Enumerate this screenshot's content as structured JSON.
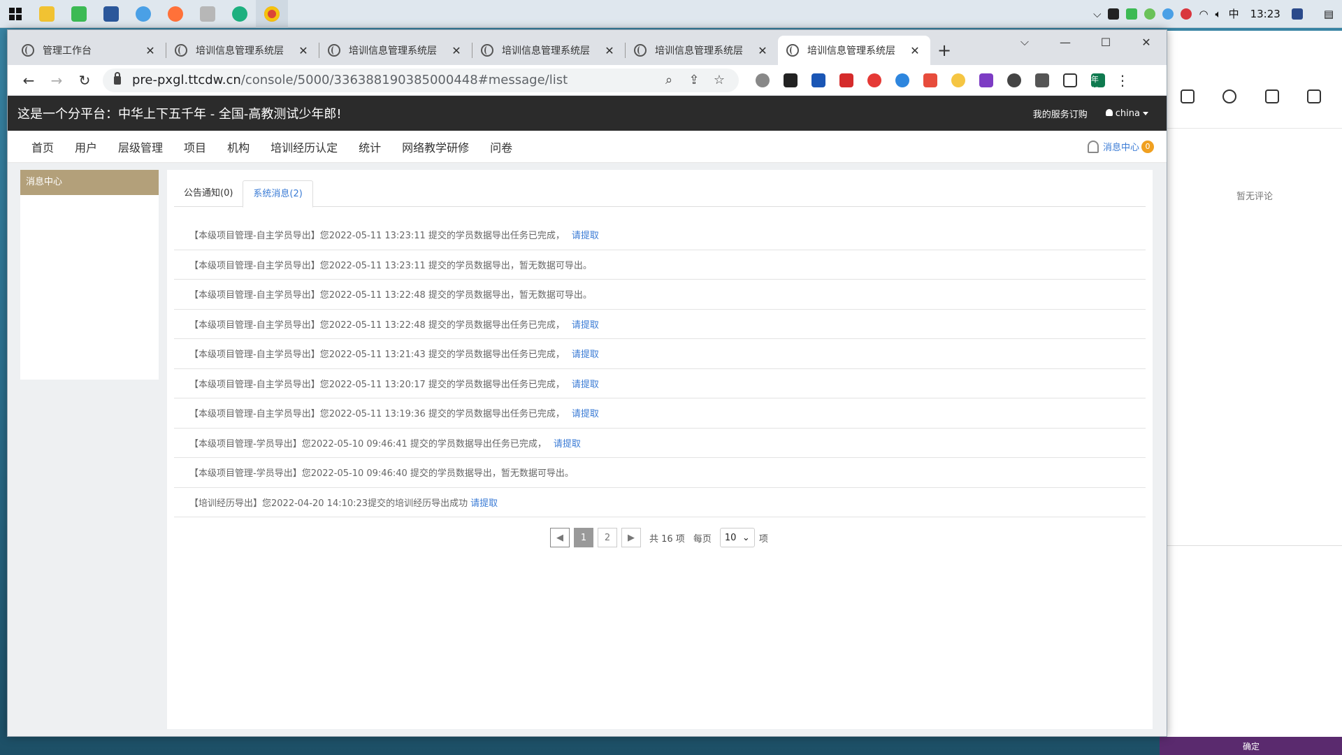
{
  "taskbar": {
    "apps": [
      {
        "name": "file-explorer",
        "color": "#f1c232"
      },
      {
        "name": "app-green-blue",
        "color": "#3cba54"
      },
      {
        "name": "word",
        "color": "#2b579a"
      },
      {
        "name": "search-app",
        "color": "#4aa0e6"
      },
      {
        "name": "firefox",
        "color": "#ff7139"
      },
      {
        "name": "app-misc",
        "color": "#b7b7b7"
      },
      {
        "name": "edge",
        "color": "#1db07f"
      },
      {
        "name": "chrome",
        "color": "#db4437"
      }
    ],
    "ime": "中",
    "clock": "13:23"
  },
  "browser": {
    "tabs": [
      {
        "title": "管理工作台"
      },
      {
        "title": "培训信息管理系统层"
      },
      {
        "title": "培训信息管理系统层"
      },
      {
        "title": "培训信息管理系统层"
      },
      {
        "title": "培训信息管理系统层"
      },
      {
        "title": "培训信息管理系统层"
      }
    ],
    "url_host": "pre-pxgl.ttcdw.cn",
    "url_path": "/console/5000/336388190385000448#message/list",
    "profile_label": "年郎"
  },
  "site": {
    "title": "这是一个分平台：中华上下五千年 - 全国-高教测试少年郎!",
    "subscription": "我的服务订购",
    "user": "china",
    "nav": [
      "首页",
      "用户",
      "层级管理",
      "项目",
      "机构",
      "培训经历认定",
      "统计",
      "网络教学研修",
      "问卷"
    ],
    "message_center": "消息中心",
    "message_count": "0"
  },
  "sidebar": {
    "active_item": "消息中心"
  },
  "content": {
    "tabs": [
      {
        "label": "公告通知(0)"
      },
      {
        "label": "系统消息(2)"
      }
    ],
    "messages": [
      {
        "text": "【本级项目管理-自主学员导出】您2022-05-11 13:23:11 提交的学员数据导出任务已完成，",
        "link": "请提取"
      },
      {
        "text": "【本级项目管理-自主学员导出】您2022-05-11 13:23:11 提交的学员数据导出，暂无数据可导出。",
        "link": ""
      },
      {
        "text": "【本级项目管理-自主学员导出】您2022-05-11 13:22:48 提交的学员数据导出，暂无数据可导出。",
        "link": ""
      },
      {
        "text": "【本级项目管理-自主学员导出】您2022-05-11 13:22:48 提交的学员数据导出任务已完成，",
        "link": "请提取"
      },
      {
        "text": "【本级项目管理-自主学员导出】您2022-05-11 13:21:43 提交的学员数据导出任务已完成，",
        "link": "请提取"
      },
      {
        "text": "【本级项目管理-自主学员导出】您2022-05-11 13:20:17 提交的学员数据导出任务已完成，",
        "link": "请提取"
      },
      {
        "text": "【本级项目管理-自主学员导出】您2022-05-11 13:19:36 提交的学员数据导出任务已完成，",
        "link": "请提取"
      },
      {
        "text": "【本级项目管理-学员导出】您2022-05-10 09:46:41 提交的学员数据导出任务已完成，",
        "link": "请提取"
      },
      {
        "text": "【本级项目管理-学员导出】您2022-05-10 09:46:40 提交的学员数据导出，暂无数据可导出。",
        "link": ""
      },
      {
        "text": "【培训经历导出】您2022-04-20 14:10:23提交的培训经历导出成功",
        "link": "请提取"
      }
    ],
    "pagination": {
      "prev": "◀",
      "pages": [
        "1",
        "2"
      ],
      "current": "1",
      "next": "▶",
      "total": "共 16 项",
      "per_page_label": "每页",
      "per_page": "10",
      "unit": "项"
    }
  },
  "background_window": {
    "empty_text": "暂无评论",
    "confirm": "确定"
  },
  "colors": {
    "header_bg": "#2b2b2b",
    "sidebar_active": "#b3a07a",
    "link": "#3a7bd5",
    "badge": "#f0a020"
  }
}
